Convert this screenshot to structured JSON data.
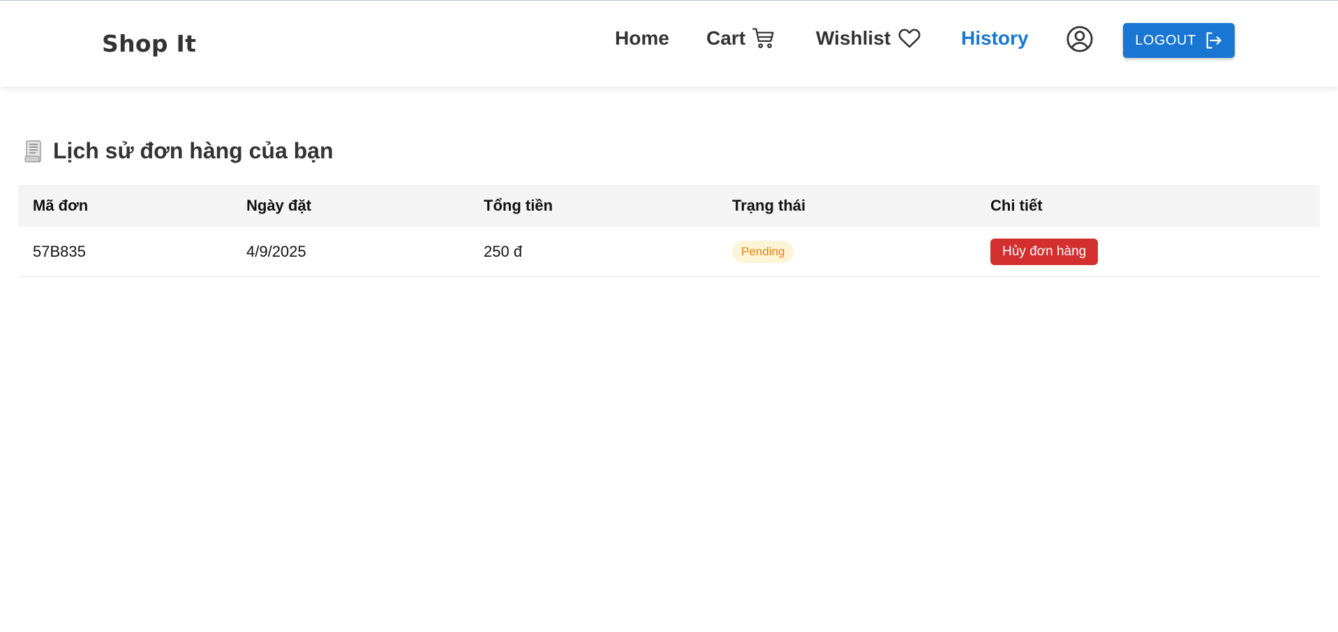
{
  "nav": {
    "brand": "Shop It",
    "links": [
      {
        "label": "Home"
      },
      {
        "label": "Cart",
        "icon": "cart-icon"
      },
      {
        "label": "Wishlist",
        "icon": "heart-icon"
      },
      {
        "label": "History",
        "active": true
      }
    ],
    "profile_icon": "account-circle-icon",
    "logout_label": "LOGOUT",
    "logout_icon": "logout-icon",
    "accent_color": "#1976d2"
  },
  "page": {
    "title_icon": "receipt-icon",
    "title": "Lịch sử đơn hàng của bạn"
  },
  "table": {
    "headers": [
      "Mã đơn",
      "Ngày đặt",
      "Tổng tiền",
      "Trạng thái",
      "Chi tiết"
    ],
    "rows": [
      {
        "order_id": "57B835",
        "date": "4/9/2025",
        "total": "250 đ",
        "status": "Pending",
        "action_label": "Hủy đơn hàng"
      }
    ],
    "status_color": "#e6840c",
    "cancel_color": "#d32f2f"
  }
}
